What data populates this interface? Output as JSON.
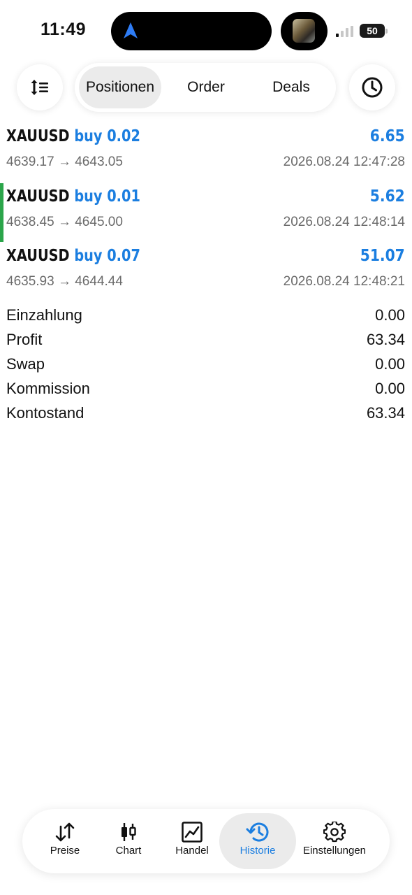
{
  "status_bar": {
    "time": "11:49",
    "battery_level": "50",
    "nav_icon": "location-arrow-icon"
  },
  "toolbar": {
    "sort_icon": "sort-list-icon",
    "clock_icon": "clock-icon",
    "tabs": [
      {
        "label": "Positionen",
        "active": true
      },
      {
        "label": "Order",
        "active": false
      },
      {
        "label": "Deals",
        "active": false
      }
    ]
  },
  "trades": [
    {
      "symbol": "XAUUSD",
      "side": "buy 0.02",
      "profit": "6.65",
      "prices": "4639.17 → 4643.05",
      "time": "2026.08.24 12:47:28",
      "selected": false
    },
    {
      "symbol": "XAUUSD",
      "side": "buy 0.01",
      "profit": "5.62",
      "prices": "4638.45 → 4645.00",
      "time": "2026.08.24 12:48:14",
      "selected": true
    },
    {
      "symbol": "XAUUSD",
      "side": "buy 0.07",
      "profit": "51.07",
      "prices": "4635.93 → 4644.44",
      "time": "2026.08.24 12:48:21",
      "selected": false
    }
  ],
  "summary": [
    {
      "label": "Einzahlung",
      "value": "0.00"
    },
    {
      "label": "Profit",
      "value": "63.34"
    },
    {
      "label": "Swap",
      "value": "0.00"
    },
    {
      "label": "Kommission",
      "value": "0.00"
    },
    {
      "label": "Kontostand",
      "value": "63.34"
    }
  ],
  "tabbar": [
    {
      "label": "Preise",
      "icon": "quotes-arrows-icon",
      "active": false
    },
    {
      "label": "Chart",
      "icon": "candlestick-icon",
      "active": false
    },
    {
      "label": "Handel",
      "icon": "trade-chart-icon",
      "active": false
    },
    {
      "label": "Historie",
      "icon": "history-icon",
      "active": true
    },
    {
      "label": "Einstellungen",
      "icon": "settings-gear-icon",
      "active": false
    }
  ],
  "colors": {
    "accent": "#1b7ee0",
    "selected_marker": "#2ba54a",
    "muted_text": "#6b6b6b"
  }
}
